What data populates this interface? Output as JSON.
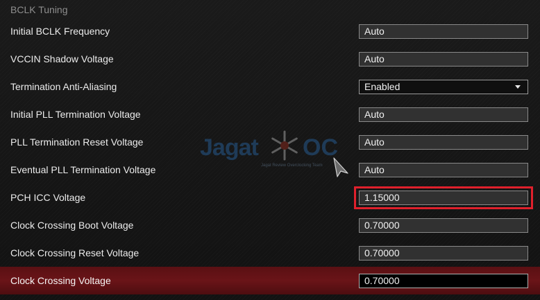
{
  "section": {
    "title": "BCLK Tuning"
  },
  "rows": [
    {
      "label": "Initial BCLK Frequency",
      "value": "Auto"
    },
    {
      "label": "VCCIN Shadow Voltage",
      "value": "Auto"
    },
    {
      "label": "Termination Anti-Aliasing",
      "value": "Enabled"
    },
    {
      "label": "Initial PLL Termination Voltage",
      "value": "Auto"
    },
    {
      "label": "PLL Termination Reset Voltage",
      "value": "Auto"
    },
    {
      "label": "Eventual PLL Termination Voltage",
      "value": "Auto"
    },
    {
      "label": "PCH ICC Voltage",
      "value": "1.15000"
    },
    {
      "label": "Clock Crossing Boot Voltage",
      "value": "0.70000"
    },
    {
      "label": "Clock Crossing Reset Voltage",
      "value": "0.70000"
    },
    {
      "label": "Clock Crossing Voltage",
      "value": "0.70000"
    }
  ],
  "watermark": {
    "left": "Jagat",
    "right": "OC",
    "tagline": "Jagat Review Overclocking Team"
  },
  "colors": {
    "highlight": "#e0202c",
    "selected_row": "#5a1013",
    "field_bg": "#313131"
  },
  "icons": {
    "dropdown": "caret-down-icon",
    "pointer": "mouse-cursor-icon",
    "watermark_logo": "snowflake-icon"
  }
}
